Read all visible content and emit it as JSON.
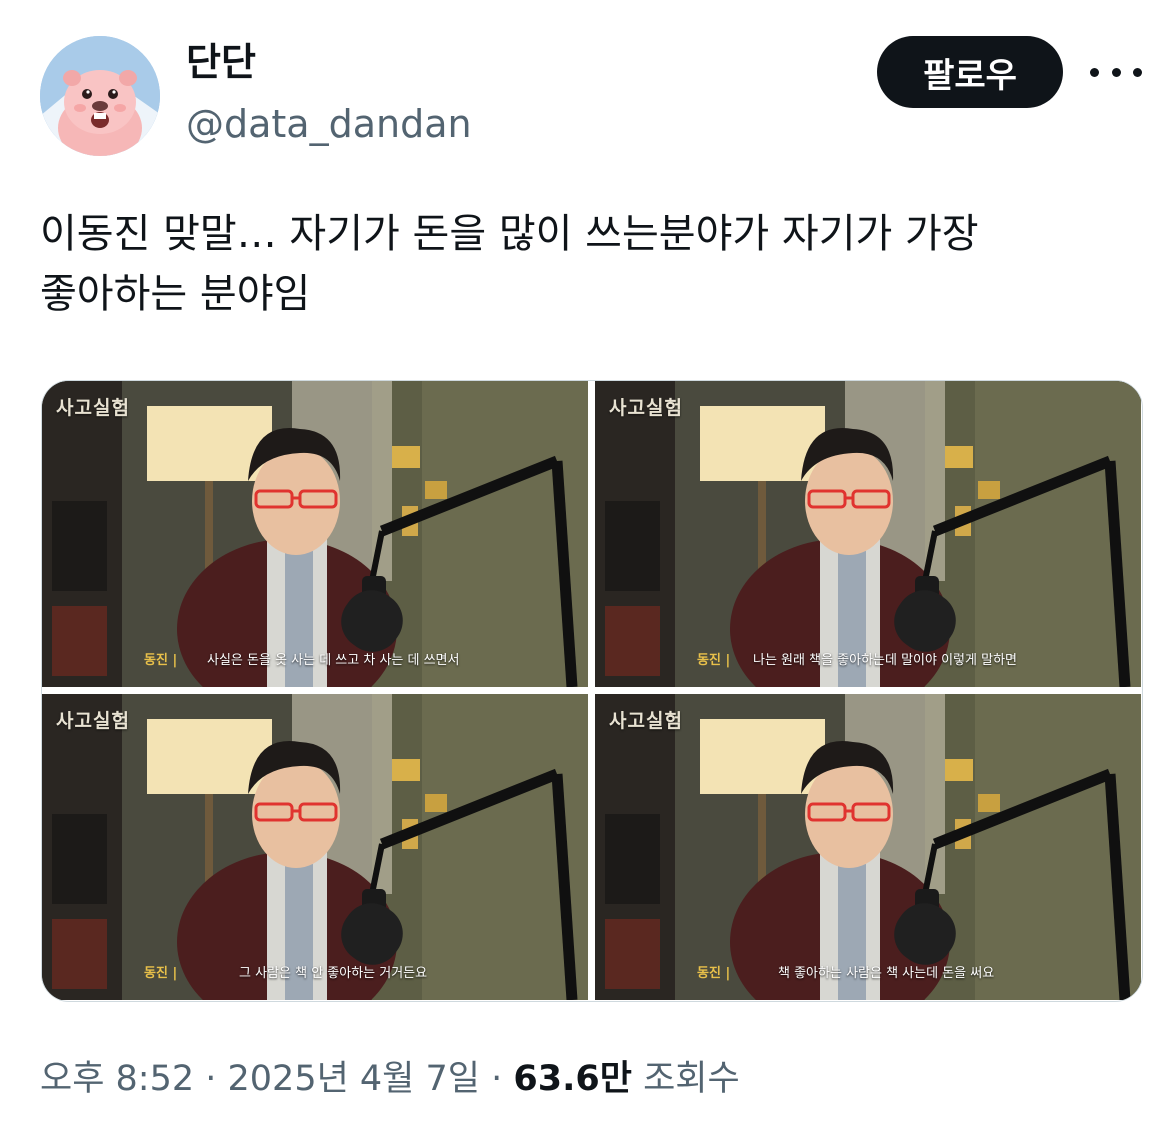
{
  "author": {
    "name": "단단",
    "handle": "@data_dandan",
    "avatar_icon": "beaver-character-avatar"
  },
  "actions": {
    "follow_label": "팔로우",
    "more_icon": "more-dots-icon"
  },
  "tweet": {
    "text": "이동진 맞말… 자기가 돈을 많이 쓰는분야가 자기가 가장\n좋아하는 분야임"
  },
  "media": [
    {
      "watermark": "사고실험",
      "speaker": "동진 |",
      "subtitle": "사실은 돈을 옷 사는 데 쓰고 차 사는 데 쓰면서"
    },
    {
      "watermark": "사고실험",
      "speaker": "동진 |",
      "subtitle": "나는 원래 책을 좋아하는데 말이야 이렇게 말하면"
    },
    {
      "watermark": "사고실험",
      "speaker": "동진 |",
      "subtitle": "그 사람은 책 안 좋아하는 거거든요"
    },
    {
      "watermark": "사고실험",
      "speaker": "동진 |",
      "subtitle": "책 좋아하는 사람은 책 사는데 돈을 써요"
    }
  ],
  "meta": {
    "time": "오후 8:52",
    "separator": " · ",
    "date": "2025년 4월 7일",
    "views_count": "63.6만",
    "views_label": " 조회수"
  },
  "colors": {
    "text": "#0f1419",
    "secondary": "#536471",
    "follow_bg": "#0f1419",
    "subtitle_speaker": "#e8c04a"
  }
}
